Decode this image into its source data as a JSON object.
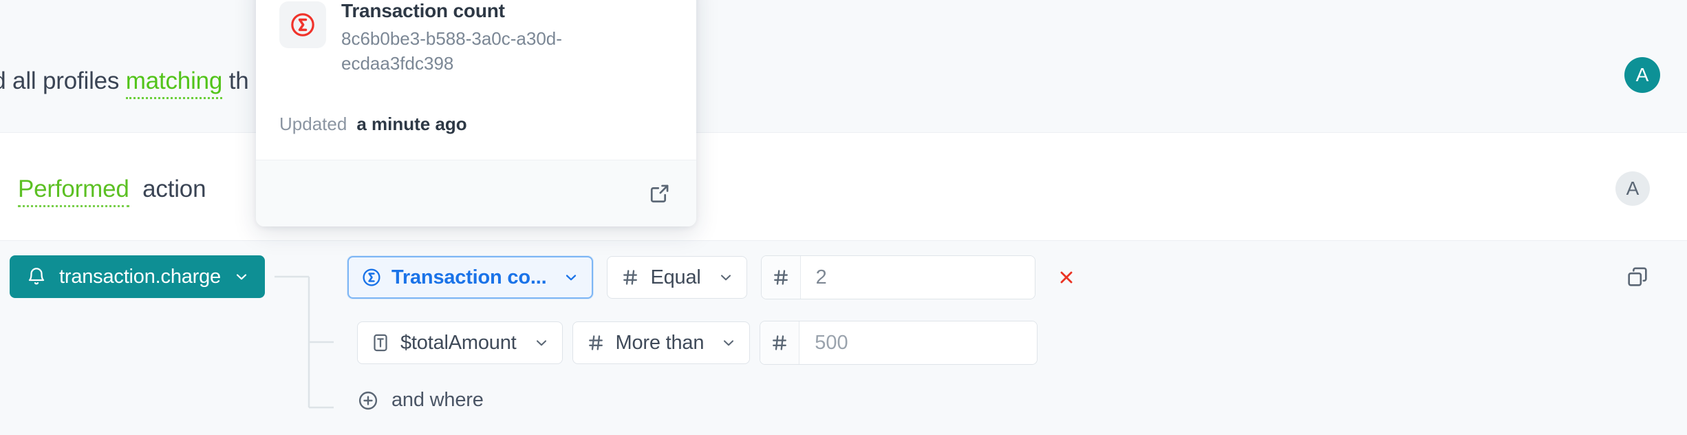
{
  "sentences": {
    "top": {
      "lead": "nd all profiles",
      "keyword": "matching",
      "trail": "th"
    },
    "middle": {
      "keyword": "Performed",
      "trail": "action"
    }
  },
  "avatars": {
    "top": {
      "initial": "A",
      "color": "#0d9196"
    },
    "middle": {
      "initial": "A",
      "color": "#e7ebee"
    }
  },
  "hover_card": {
    "icon": "sigma-circle-icon",
    "icon_color": "#f0332b",
    "title": "Transaction count",
    "id": "8c6b0be3-b588-3a0c-a30d-ecdaa3fdc398",
    "updated_label": "Updated",
    "updated_value": "a minute ago",
    "footer_action": "open-external-icon"
  },
  "trigger": {
    "icon": "bell-icon",
    "label": "transaction.charge",
    "chevron": "chevron-down-icon",
    "color": "#0e8f94"
  },
  "conditions": [
    {
      "field_icon": "sigma-circle-icon",
      "field_label": "Transaction co...",
      "field_selected": true,
      "operator_icon": "hash-icon",
      "operator_label": "Equal",
      "value_icon": "hash-icon",
      "value": "2",
      "value_is_placeholder": false,
      "remove_icon": "close-icon"
    },
    {
      "field_icon": "text-field-icon",
      "field_label": "$totalAmount",
      "field_selected": false,
      "operator_icon": "hash-icon",
      "operator_label": "More than",
      "value_icon": "hash-icon",
      "value": "500",
      "value_is_placeholder": true,
      "remove_icon": null
    }
  ],
  "add_condition": {
    "icon": "plus-circle-icon",
    "label": "and where"
  },
  "duplicate_button": {
    "icon": "duplicate-icon"
  },
  "colors": {
    "accent_teal": "#0e8f94",
    "accent_green": "#52c41a",
    "accent_blue": "#1a73e8",
    "danger_red": "#ea3323",
    "page_gray": "#f7f9fb"
  }
}
